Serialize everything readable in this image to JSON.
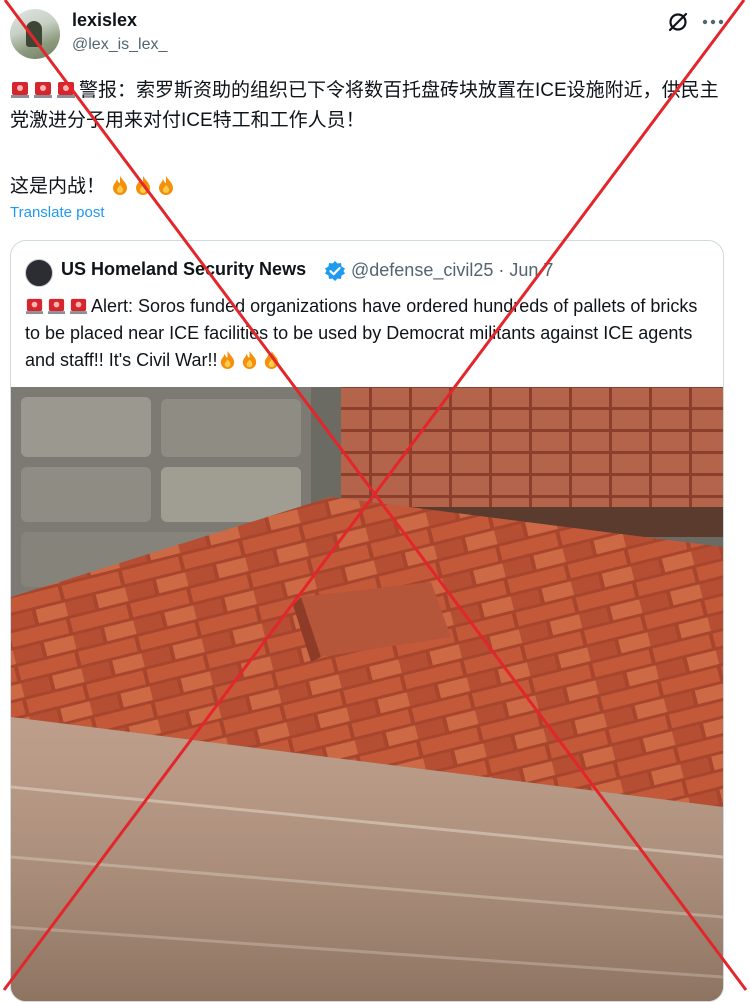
{
  "post": {
    "author_name": "lexislex",
    "author_handle": "@lex_is_lex_",
    "text_line1": "警报：索罗斯资助的组织已下令将数百托盘砖块放置在ICE设施附近，供民主党激进分子用来对付ICE特工和工作人员！",
    "text_line2": "这是内战！",
    "translate_label": "Translate post"
  },
  "quote": {
    "author_name": "US Homeland Security News",
    "author_handle": "@defense_civil25 · Jun 7",
    "text": "Alert: Soros funded organizations have ordered hundreds of pallets of bricks to be placed near ICE facilities to be used by Democrat militants against ICE agents and staff!! It's Civil War!!"
  },
  "icons": {
    "siren": "police-light-emoji",
    "fire": "fire-emoji",
    "grok": "grok-icon",
    "more": "more-icon",
    "verified": "verified-badge-icon"
  },
  "colors": {
    "link": "#1d9bf0",
    "secondary_text": "#536471",
    "overlay_x": "#e3262b"
  }
}
